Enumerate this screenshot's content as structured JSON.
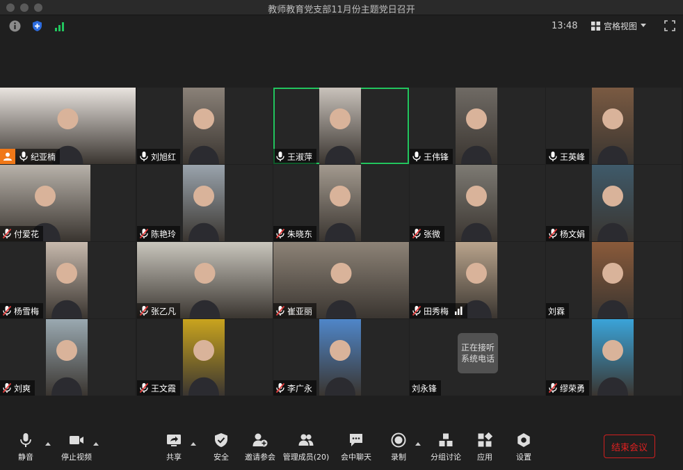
{
  "window": {
    "title": "教师教育党支部11月份主题党日召开"
  },
  "topbar": {
    "time": "13:48",
    "view_label": "宫格视图"
  },
  "colors": {
    "active_speaker_border": "#22c55e",
    "host_badge": "#f07818",
    "end_button": "#e02020",
    "connection": "#22c55e",
    "security": "#2d6cdf"
  },
  "participants": [
    {
      "name": "纪亚楠",
      "muted": false,
      "host": true,
      "active": false
    },
    {
      "name": "刘旭红",
      "muted": false,
      "host": false,
      "active": false
    },
    {
      "name": "王淑萍",
      "muted": false,
      "host": false,
      "active": true
    },
    {
      "name": "王伟锋",
      "muted": false,
      "host": false,
      "active": false
    },
    {
      "name": "王英峰",
      "muted": false,
      "host": false,
      "active": false
    },
    {
      "name": "付爱花",
      "muted": true,
      "host": false,
      "active": false
    },
    {
      "name": "陈艳玲",
      "muted": true,
      "host": false,
      "active": false
    },
    {
      "name": "朱晓东",
      "muted": true,
      "host": false,
      "active": false
    },
    {
      "name": "张微",
      "muted": true,
      "host": false,
      "active": false
    },
    {
      "name": "杨文娟",
      "muted": true,
      "host": false,
      "active": false
    },
    {
      "name": "杨雪梅",
      "muted": true,
      "host": false,
      "active": false
    },
    {
      "name": "张乙凡",
      "muted": true,
      "host": false,
      "active": false
    },
    {
      "name": "崔亚丽",
      "muted": true,
      "host": false,
      "active": false
    },
    {
      "name": "田秀梅",
      "muted": true,
      "host": false,
      "active": false
    },
    {
      "name": "刘霖",
      "muted": false,
      "host": false,
      "active": false
    },
    {
      "name": "刘爽",
      "muted": true,
      "host": false,
      "active": false
    },
    {
      "name": "王文霞",
      "muted": true,
      "host": false,
      "active": false
    },
    {
      "name": "李广永",
      "muted": true,
      "host": false,
      "active": false
    },
    {
      "name": "刘永锋",
      "muted": false,
      "host": false,
      "active": false
    },
    {
      "name": "缪荣勇",
      "muted": true,
      "host": false,
      "active": false
    }
  ],
  "phone_call": {
    "text": "正在接听系统电话"
  },
  "toolbar": {
    "mute": "静音",
    "stop_video": "停止视频",
    "share": "共享",
    "security": "安全",
    "invite": "邀请参会",
    "manage": "管理成员(20)",
    "chat": "会中聊天",
    "record": "录制",
    "breakout": "分组讨论",
    "apps": "应用",
    "settings": "设置",
    "end": "结束会议"
  }
}
